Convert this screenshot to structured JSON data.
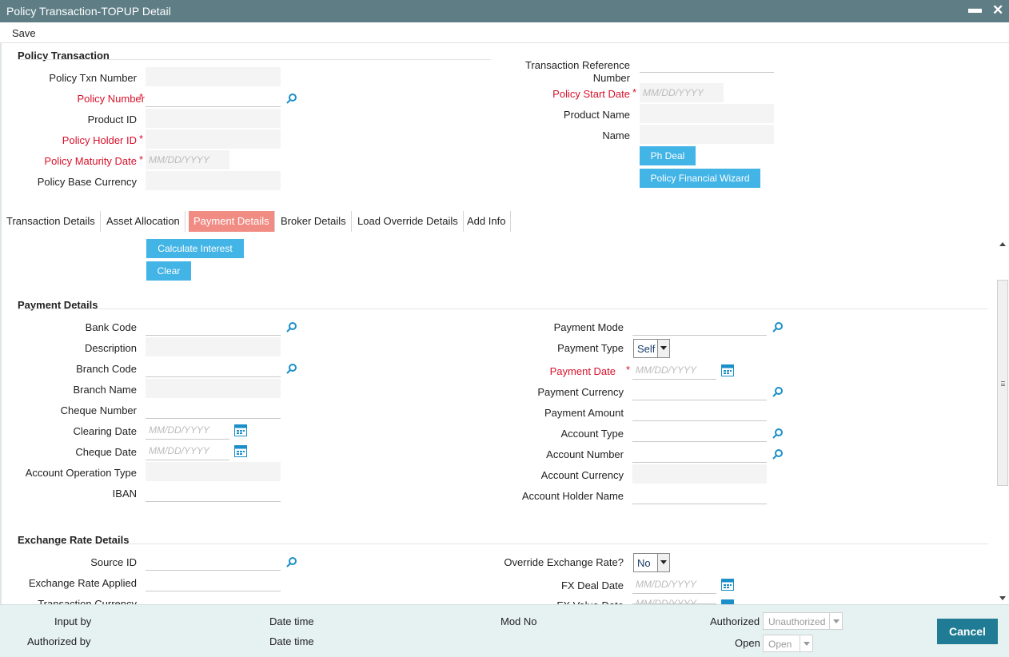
{
  "window": {
    "title": "Policy Transaction-TOPUP Detail",
    "minimize": "▬",
    "close": "✕"
  },
  "menu": {
    "save": "Save"
  },
  "policy_transaction": {
    "section_title": "Policy Transaction",
    "policy_txn_number_label": "Policy Txn Number",
    "policy_number_label": "Policy Number",
    "product_id_label": "Product ID",
    "policy_holder_id_label": "Policy Holder ID",
    "policy_maturity_date_label": "Policy Maturity Date",
    "policy_maturity_date_placeholder": "MM/DD/YYYY",
    "policy_base_currency_label": "Policy Base Currency",
    "transaction_reference_label_1": "Transaction Reference",
    "transaction_reference_label_2": "Number",
    "policy_start_date_label": "Policy Start Date",
    "policy_start_date_placeholder": "MM/DD/YYYY",
    "product_name_label": "Product Name",
    "name_label": "Name",
    "ph_deal_button": "Ph Deal",
    "financial_wizard_button": "Policy Financial Wizard",
    "required_mark": "*"
  },
  "tabs": [
    {
      "label": "Transaction Details",
      "active": false
    },
    {
      "label": "Asset Allocation",
      "active": false
    },
    {
      "label": "Payment Details",
      "active": true
    },
    {
      "label": "Broker Details",
      "active": false
    },
    {
      "label": "Load Override Details",
      "active": false
    },
    {
      "label": "Add Info",
      "active": false
    }
  ],
  "actions": {
    "calculate_interest": "Calculate Interest",
    "clear": "Clear"
  },
  "payment_details": {
    "section_title": "Payment Details",
    "bank_code_label": "Bank Code",
    "description_label": "Description",
    "branch_code_label": "Branch Code",
    "branch_name_label": "Branch Name",
    "cheque_number_label": "Cheque Number",
    "clearing_date_label": "Clearing Date",
    "clearing_date_placeholder": "MM/DD/YYYY",
    "cheque_date_label": "Cheque Date",
    "cheque_date_placeholder": "MM/DD/YYYY",
    "account_operation_type_label": "Account Operation Type",
    "iban_label": "IBAN",
    "payment_mode_label": "Payment Mode",
    "payment_type_label": "Payment Type",
    "payment_type_value": "Self",
    "payment_date_label": "Payment Date",
    "payment_date_placeholder": "MM/DD/YYYY",
    "payment_currency_label": "Payment Currency",
    "payment_amount_label": "Payment Amount",
    "account_type_label": "Account Type",
    "account_number_label": "Account Number",
    "account_currency_label": "Account Currency",
    "account_holder_name_label": "Account Holder Name"
  },
  "exchange_rate": {
    "section_title": "Exchange Rate Details",
    "source_id_label": "Source ID",
    "exchange_rate_applied_label": "Exchange Rate Applied",
    "transaction_currency_label": "Transaction Currency",
    "override_label": "Override Exchange Rate?",
    "override_value": "No",
    "fx_deal_date_label": "FX Deal Date",
    "fx_deal_date_placeholder": "MM/DD/YYYY",
    "fx_value_date_label": "FX Value Date",
    "fx_value_date_placeholder": "MM/DD/YYYY"
  },
  "footer": {
    "input_by": "Input by",
    "authorized_by": "Authorized by",
    "date_time_1": "Date time",
    "date_time_2": "Date time",
    "mod_no": "Mod No",
    "authorized_label": "Authorized",
    "authorized_value": "Unauthorized",
    "open_label": "Open",
    "open_value": "Open",
    "cancel": "Cancel"
  },
  "colors": {
    "titlebar": "#5e7d85",
    "button": "#42b4e6",
    "active_tab": "#f08c84",
    "required": "#d8112a",
    "cancel": "#1f7c94",
    "footer": "#e6f1f1"
  }
}
